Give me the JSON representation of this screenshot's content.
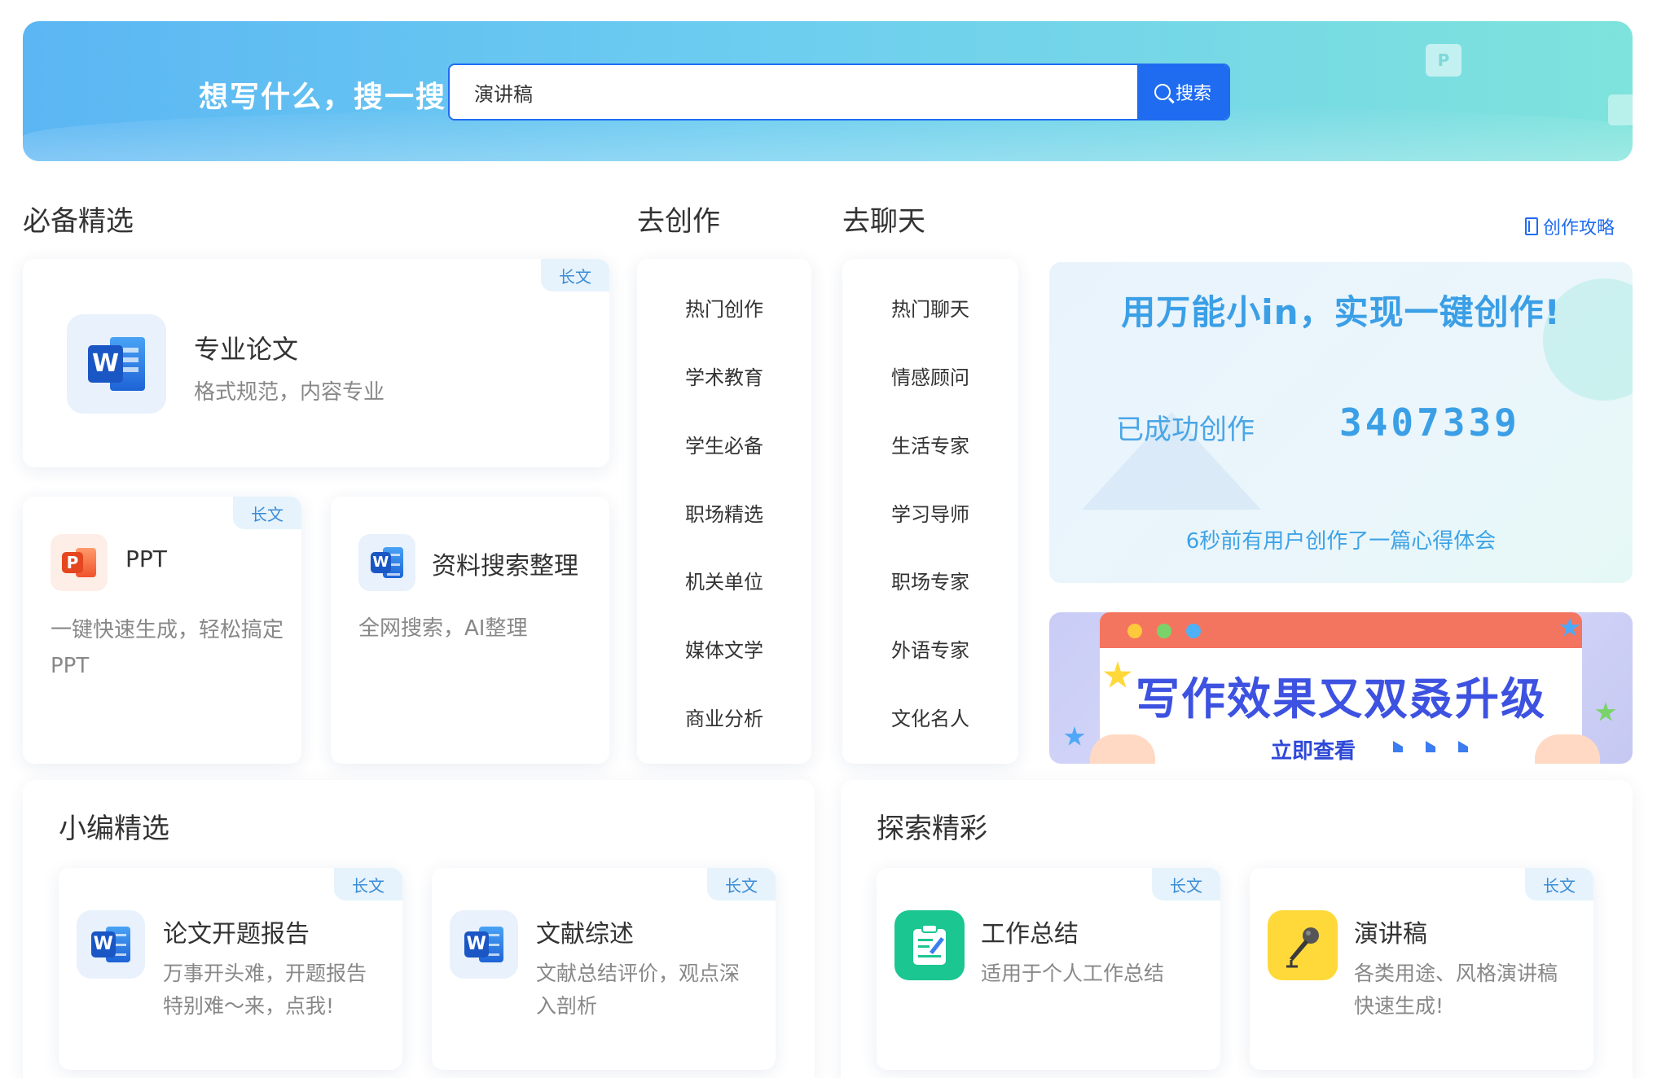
{
  "banner": {
    "slogan": "想写什么，搜一搜",
    "search_value": "演讲稿",
    "search_button": "搜索",
    "search_icon": "search-icon"
  },
  "sections": {
    "essentials": "必备精选",
    "create": "去创作",
    "chat": "去聊天",
    "guide_link": "创作攻略"
  },
  "featured_cards": [
    {
      "title": "专业论文",
      "desc": "格式规范，内容专业",
      "tag": "长文",
      "icon": "word-icon"
    },
    {
      "title": "PPT",
      "desc": "一键快速生成，轻松搞定PPT",
      "tag": "长文",
      "icon": "ppt-icon"
    },
    {
      "title": "资料搜索整理",
      "desc": "全网搜索，AI整理",
      "tag": "",
      "icon": "word-icon"
    }
  ],
  "create_menu": [
    "热门创作",
    "学术教育",
    "学生必备",
    "职场精选",
    "机关单位",
    "媒体文学",
    "商业分析"
  ],
  "chat_menu": [
    "热门聊天",
    "情感顾问",
    "生活专家",
    "学习导师",
    "职场专家",
    "外语专家",
    "文化名人"
  ],
  "stats": {
    "headline": "用万能小in，实现一键创作!",
    "label": "已成功创作",
    "count": "3407339",
    "recent": "6秒前有用户创作了一篇心得体会"
  },
  "promo": {
    "title": "写作效果又双叒升级",
    "cta": "立即查看"
  },
  "editor_picks": {
    "title": "小编精选",
    "cards": [
      {
        "title": "论文开题报告",
        "desc": "万事开头难，开题报告特别难～来，点我!",
        "tag": "长文",
        "icon": "word-icon"
      },
      {
        "title": "文献综述",
        "desc": "文献总结评价，观点深入剖析",
        "tag": "长文",
        "icon": "word-icon"
      }
    ]
  },
  "explore": {
    "title": "探索精彩",
    "cards": [
      {
        "title": "工作总结",
        "desc": "适用于个人工作总结",
        "tag": "长文",
        "icon": "clipboard-pen-icon"
      },
      {
        "title": "演讲稿",
        "desc": "各类用途、风格演讲稿快速生成!",
        "tag": "长文",
        "icon": "microphone-icon"
      }
    ]
  },
  "colors": {
    "accent": "#1f6cf0",
    "tag_bg": "#e6f3fc",
    "tag_text": "#3a8bd6"
  }
}
